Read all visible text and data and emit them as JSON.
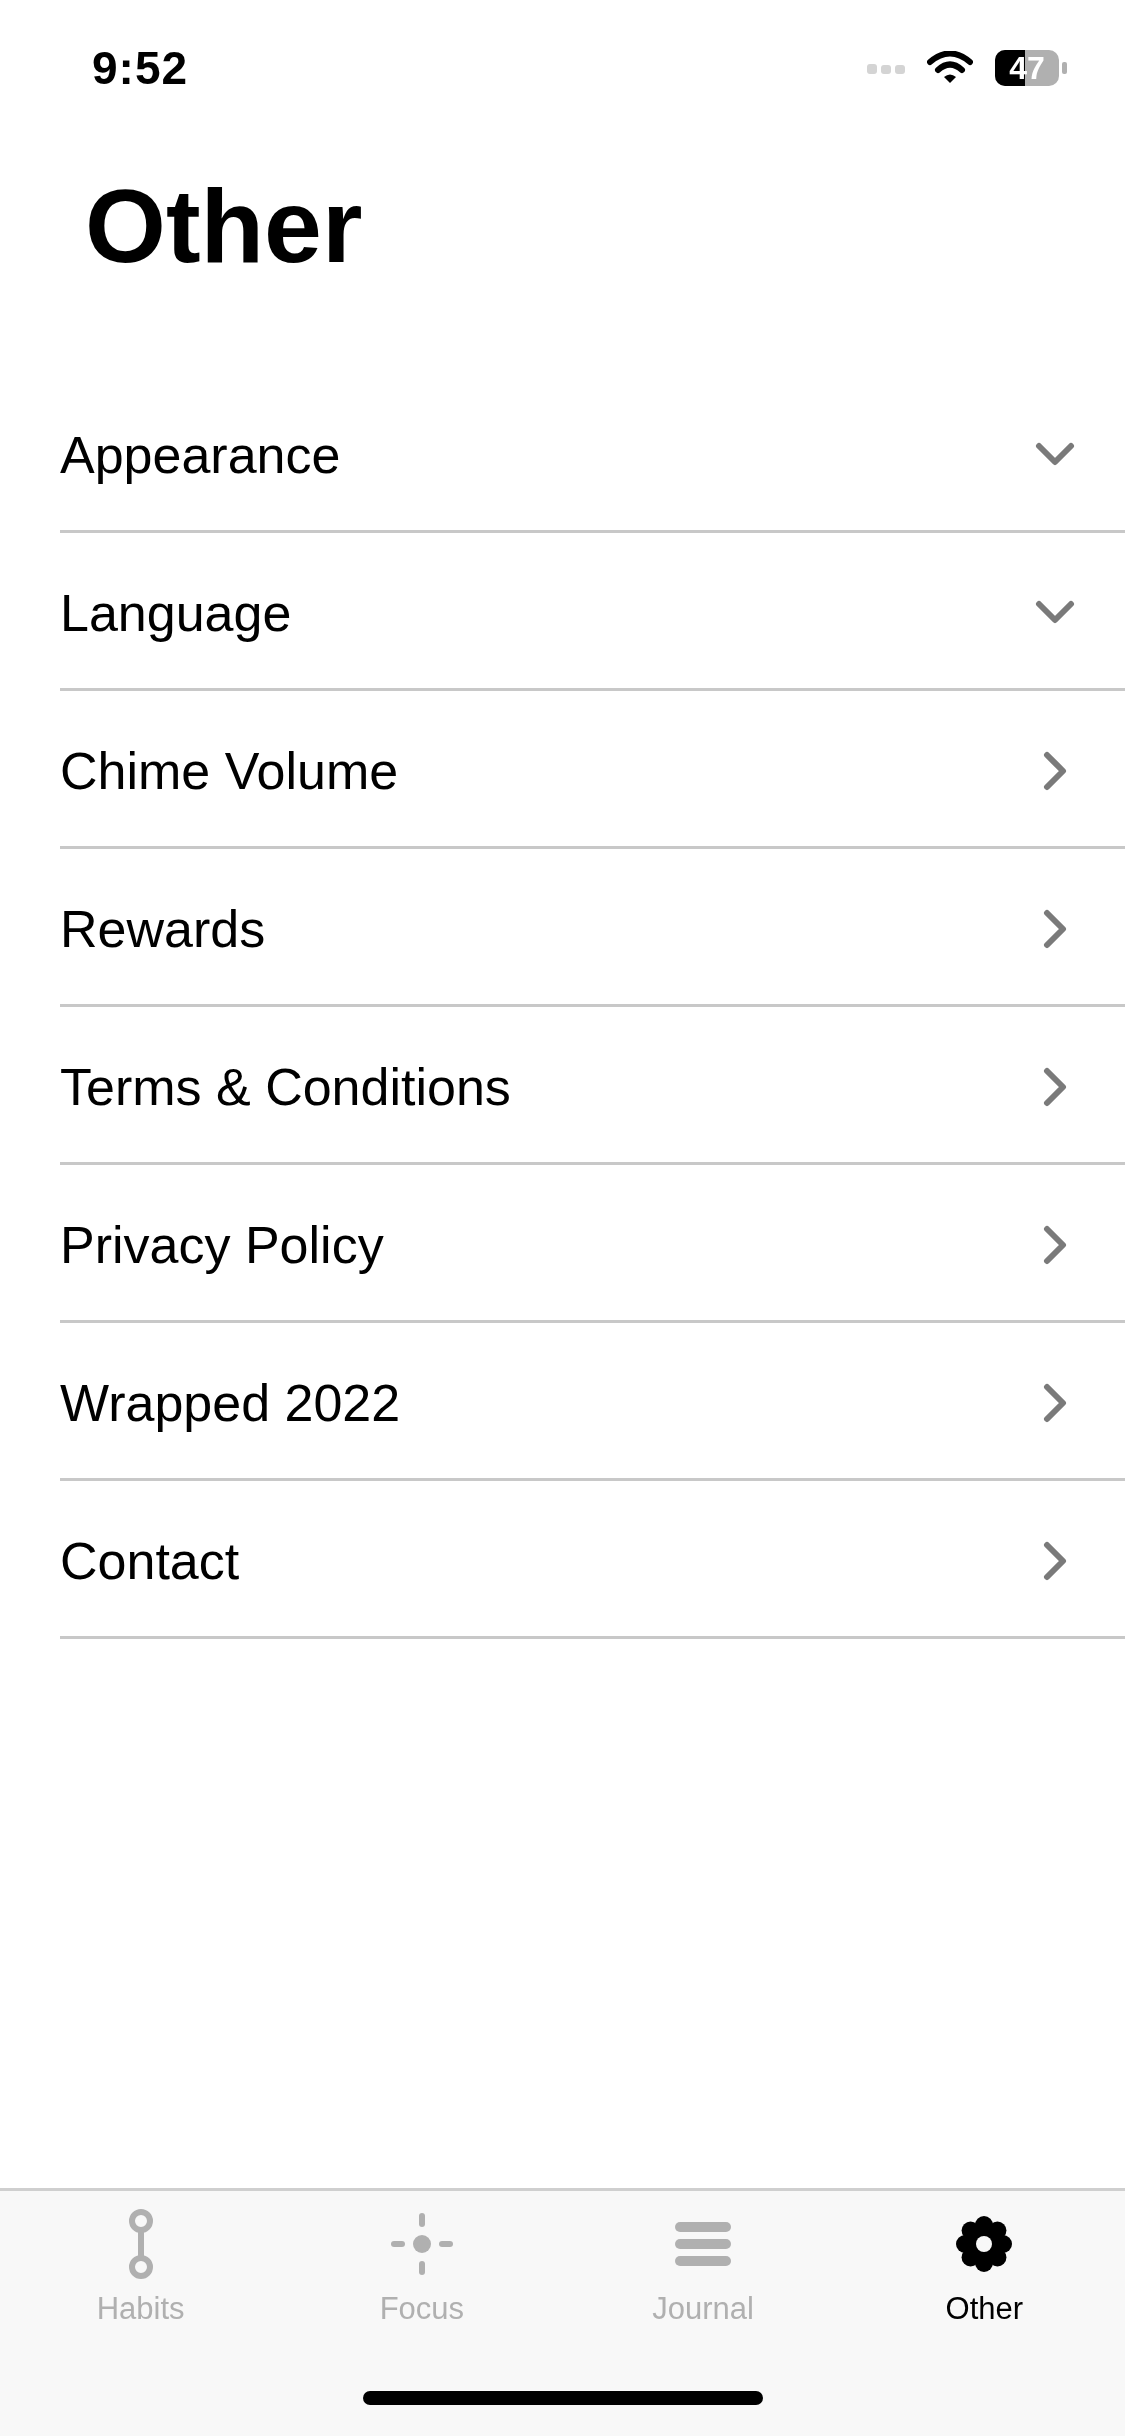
{
  "status_bar": {
    "time": "9:52",
    "battery": "47"
  },
  "title": "Other",
  "rows": [
    {
      "label": "Appearance",
      "kind": "expand"
    },
    {
      "label": "Language",
      "kind": "expand"
    },
    {
      "label": "Chime Volume",
      "kind": "link"
    },
    {
      "label": "Rewards",
      "kind": "link"
    },
    {
      "label": "Terms & Conditions",
      "kind": "link"
    },
    {
      "label": "Privacy Policy",
      "kind": "link"
    },
    {
      "label": "Wrapped 2022",
      "kind": "link"
    },
    {
      "label": "Contact",
      "kind": "link"
    }
  ],
  "tabs": [
    {
      "label": "Habits",
      "selected": false
    },
    {
      "label": "Focus",
      "selected": false
    },
    {
      "label": "Journal",
      "selected": false
    },
    {
      "label": "Other",
      "selected": true
    }
  ]
}
